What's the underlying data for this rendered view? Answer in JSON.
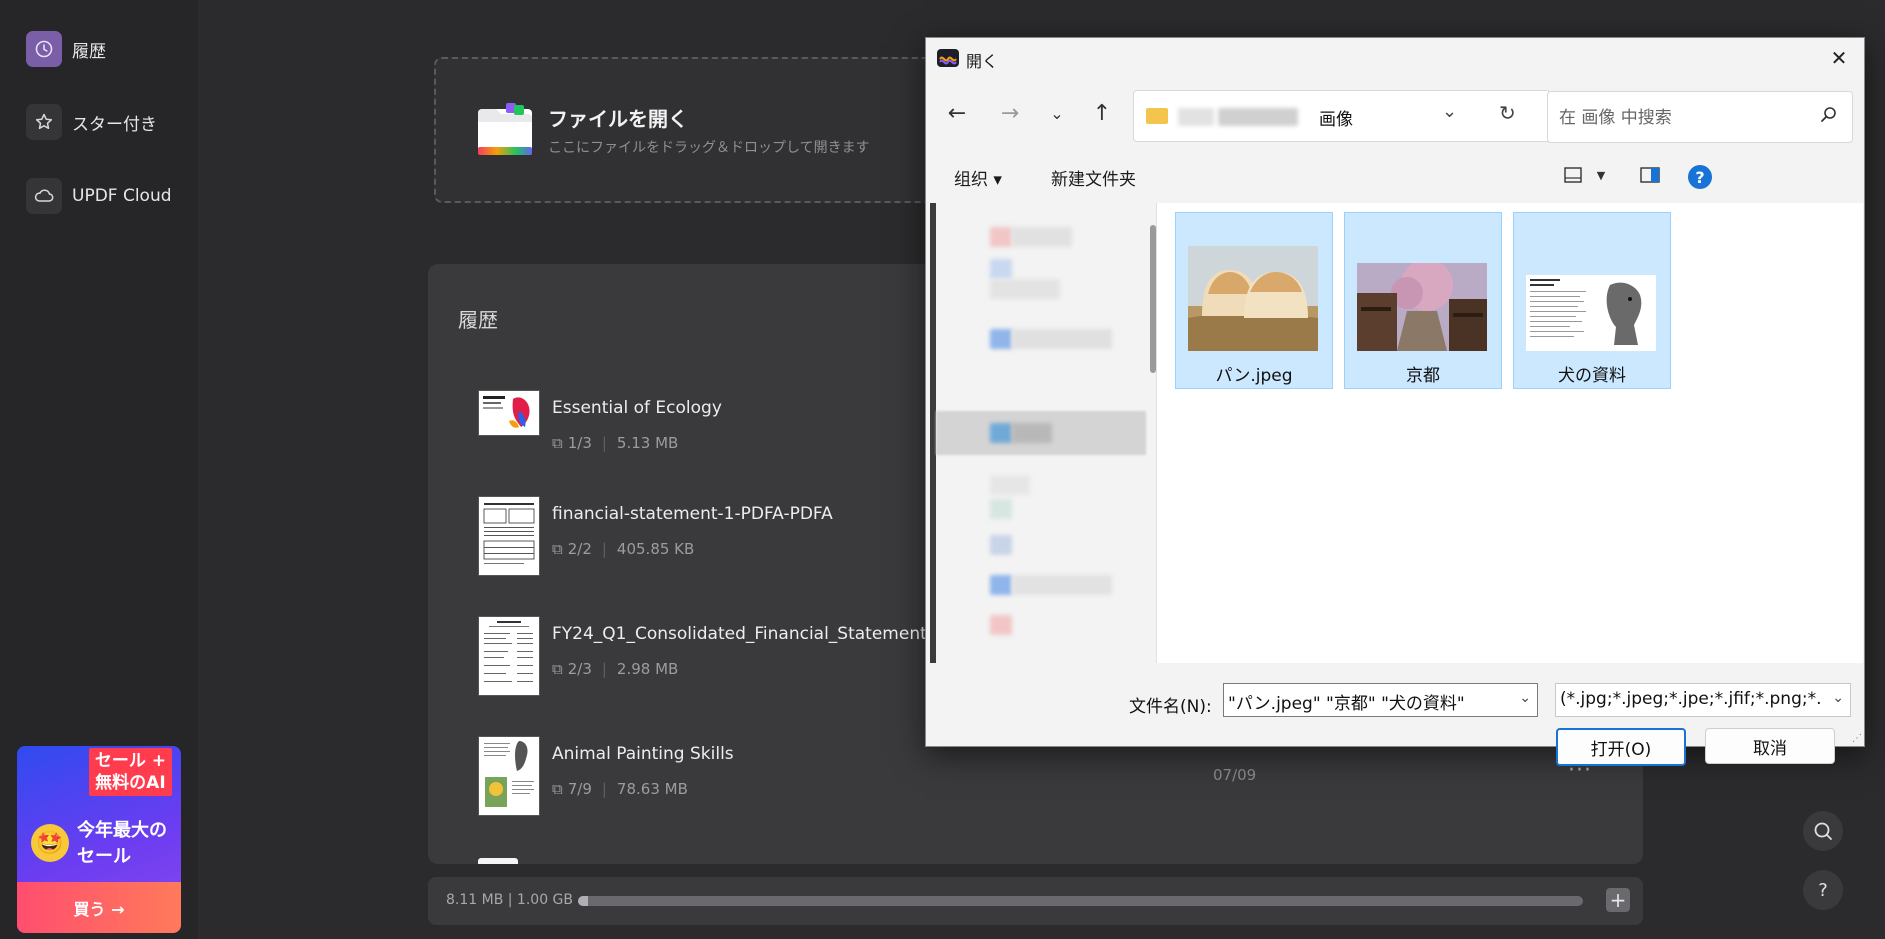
{
  "sidebar": {
    "items": [
      {
        "label": "履歴",
        "icon": "clock-icon",
        "active": true
      },
      {
        "label": "スター付き",
        "icon": "star-icon",
        "active": false
      },
      {
        "label": "UPDF Cloud",
        "icon": "cloud-icon",
        "active": false
      }
    ],
    "promo": {
      "badge_line1": "セール +",
      "badge_line2": "無料のAI",
      "emoji": "🤩",
      "headline": "今年最大のセール",
      "buy_label": "買う →"
    }
  },
  "dropzone": {
    "title": "ファイルを開く",
    "subtitle": "ここにファイルをドラッグ＆ドロップして開きます"
  },
  "history": {
    "title": "履歴",
    "files": [
      {
        "name": "Essential of Ecology",
        "pages": "1/3",
        "size": "5.13 MB",
        "date": ""
      },
      {
        "name": "financial-statement-1-PDFA-PDFA",
        "pages": "2/2",
        "size": "405.85 KB",
        "date": ""
      },
      {
        "name": "FY24_Q1_Consolidated_Financial_Statements",
        "pages": "2/3",
        "size": "2.98 MB",
        "date": ""
      },
      {
        "name": "Animal Painting Skills",
        "pages": "7/9",
        "size": "78.63 MB",
        "date": "07/09"
      }
    ]
  },
  "storage": {
    "text": "8.11 MB | 1.00 GB",
    "used_fraction": 0.008,
    "plus_label": "+"
  },
  "dialog": {
    "title": "開く",
    "close_label": "✕",
    "address_current": "画像",
    "search_placeholder": "在 画像 中搜索",
    "organize_label": "组织 ▾",
    "new_folder_label": "新建文件夹",
    "help_label": "?",
    "files": [
      {
        "label": "パン.jpeg"
      },
      {
        "label": "京都"
      },
      {
        "label": "犬の資料"
      }
    ],
    "filename_label": "文件名(N):",
    "filename_value": "\"パン.jpeg\" \"京都\" \"犬の資料\"",
    "filetype_value": "(*.jpg;*.jpeg;*.jpe;*.jfif;*.png;*.",
    "open_label": "打开(O)",
    "cancel_label": "取消"
  },
  "colors": {
    "accent_purple": "#7a5ea8",
    "selection_blue": "#cce8ff",
    "primary_button_border": "#1773d6"
  }
}
